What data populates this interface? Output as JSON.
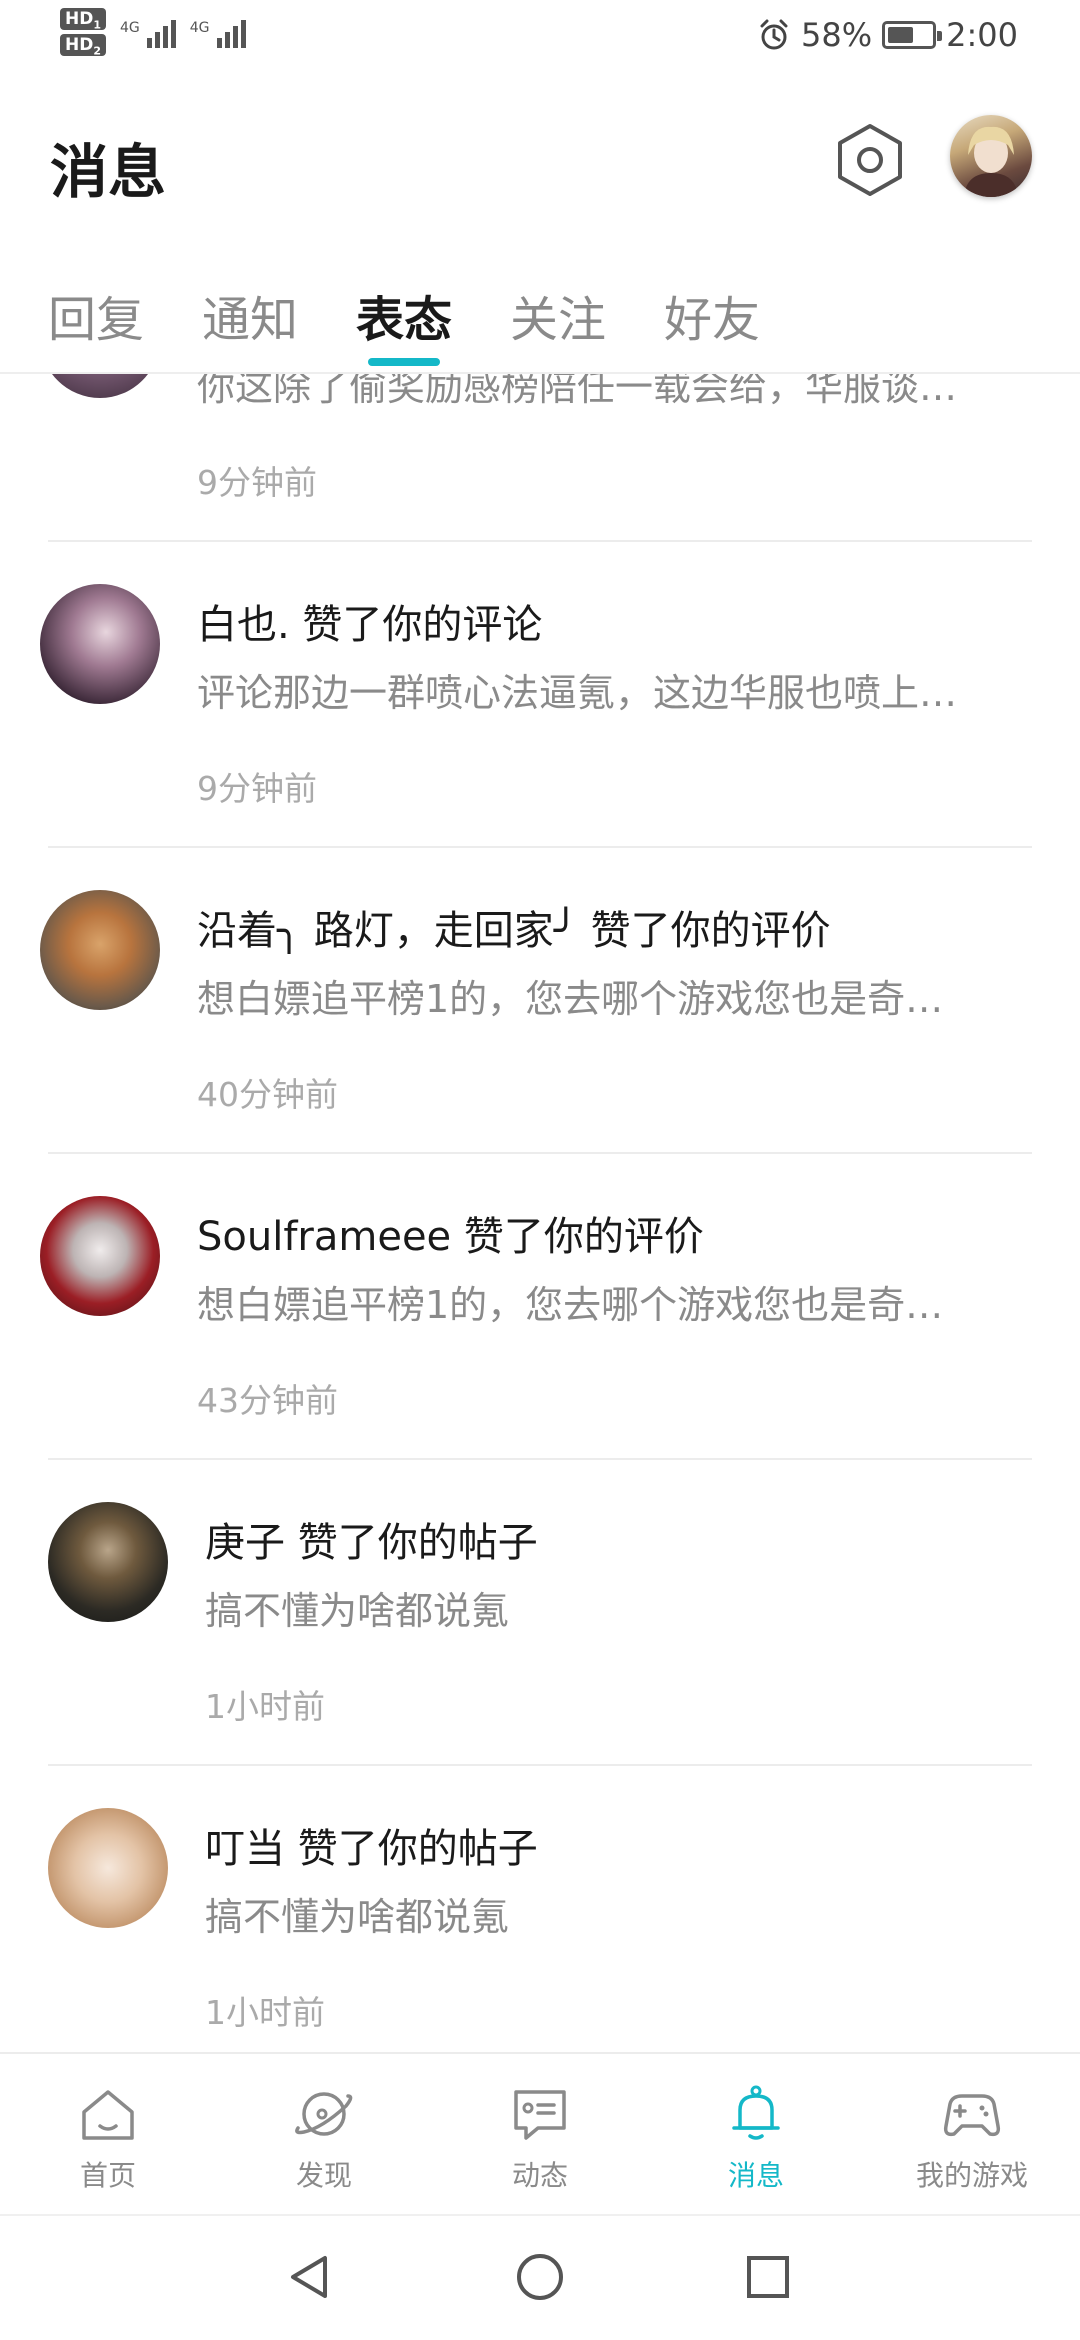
{
  "status_bar": {
    "hd1": "HD",
    "hd1_num": "1",
    "hd2": "HD",
    "hd2_num": "2",
    "net1": "4G",
    "net2": "4G",
    "battery_percent": "58%",
    "battery_level": 0.58,
    "time": "2:00"
  },
  "header": {
    "title": "消息"
  },
  "tabs": [
    {
      "label": "回复",
      "active": false
    },
    {
      "label": "通知",
      "active": false
    },
    {
      "label": "表态",
      "active": true
    },
    {
      "label": "关注",
      "active": false
    },
    {
      "label": "好友",
      "active": false
    }
  ],
  "items": [
    {
      "title": "",
      "preview": "你这除了偷奖励感榜陪任一载会给，华服谈…",
      "time": "9分钟前"
    },
    {
      "title": "白也. 赞了你的评论",
      "preview": "评论那边一群喷心法逼氪，这边华服也喷上…",
      "time": "9分钟前"
    },
    {
      "title": "沿着╮ 路灯，走回家╯  赞了你的评价",
      "preview": "想白嫖追平榜1的，您去哪个游戏您也是奇…",
      "time": "40分钟前"
    },
    {
      "title": "Soulframeee 赞了你的评价",
      "preview": "想白嫖追平榜1的，您去哪个游戏您也是奇…",
      "time": "43分钟前"
    },
    {
      "title": "庚子 赞了你的帖子",
      "preview": "搞不懂为啥都说氪",
      "time": "1小时前"
    },
    {
      "title": "叮当 赞了你的帖子",
      "preview": "搞不懂为啥都说氪",
      "time": "1小时前"
    }
  ],
  "bottom_nav": [
    {
      "label": "首页",
      "icon": "home-icon",
      "active": false
    },
    {
      "label": "发现",
      "icon": "planet-icon",
      "active": false
    },
    {
      "label": "动态",
      "icon": "chat-icon",
      "active": false
    },
    {
      "label": "消息",
      "icon": "bell-icon",
      "active": true
    },
    {
      "label": "我的游戏",
      "icon": "gamepad-icon",
      "active": false
    }
  ],
  "colors": {
    "accent": "#14b8c8",
    "text_primary": "#1a1a1a",
    "text_secondary": "#8a8a8a"
  }
}
